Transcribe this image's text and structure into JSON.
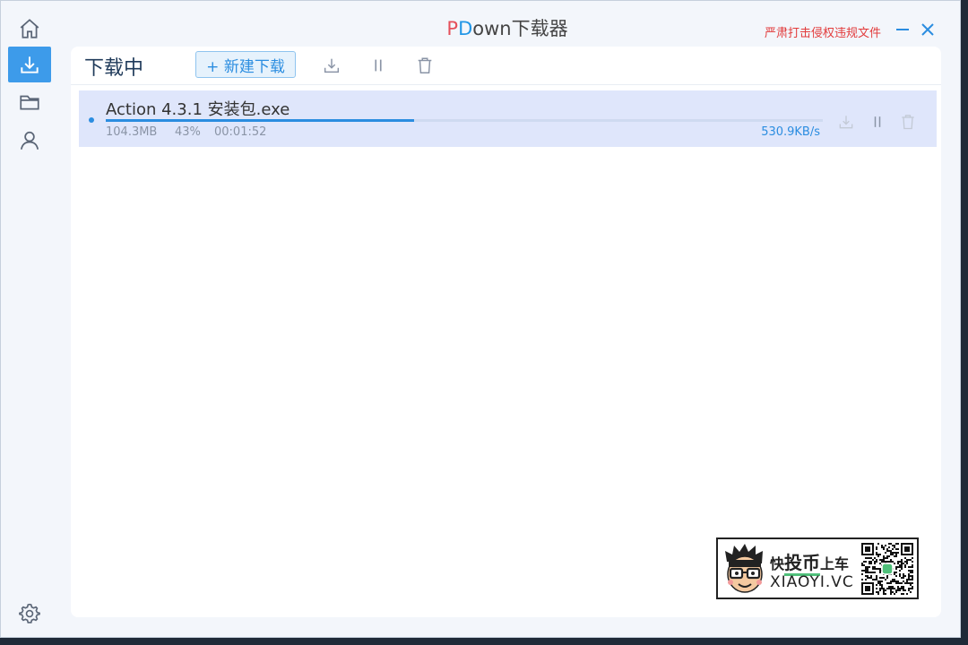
{
  "app": {
    "title_p": "P",
    "title_d": "D",
    "title_rest": "own下载器",
    "notice": "严肃打击侵权违规文件"
  },
  "sidebar": {
    "items": [
      {
        "icon": "home-icon",
        "active": false
      },
      {
        "icon": "download-icon",
        "active": true
      },
      {
        "icon": "folder-icon",
        "active": false
      },
      {
        "icon": "user-icon",
        "active": false
      },
      {
        "icon": "gear-icon",
        "active": false
      }
    ]
  },
  "toolbar": {
    "page_title": "下载中",
    "new_download_label": "+ 新建下载",
    "icons": [
      "download-all-icon",
      "pause-all-icon",
      "delete-all-icon"
    ]
  },
  "tasks": [
    {
      "name": "Action 4.3.1 安装包.exe",
      "size": "104.3MB",
      "percent": "43%",
      "progress": 0.43,
      "elapsed": "00:01:52",
      "speed": "530.9KB/s"
    }
  ],
  "watermark": {
    "line1_a": "快",
    "line1_b": "投币",
    "line1_c": "上车",
    "line2": "XIAOYI.VC"
  },
  "colors": {
    "accent": "#2b8de0",
    "sidebar_active": "#3d9bea",
    "notice": "#e23b3b",
    "row_bg": "#dfe6fb"
  }
}
